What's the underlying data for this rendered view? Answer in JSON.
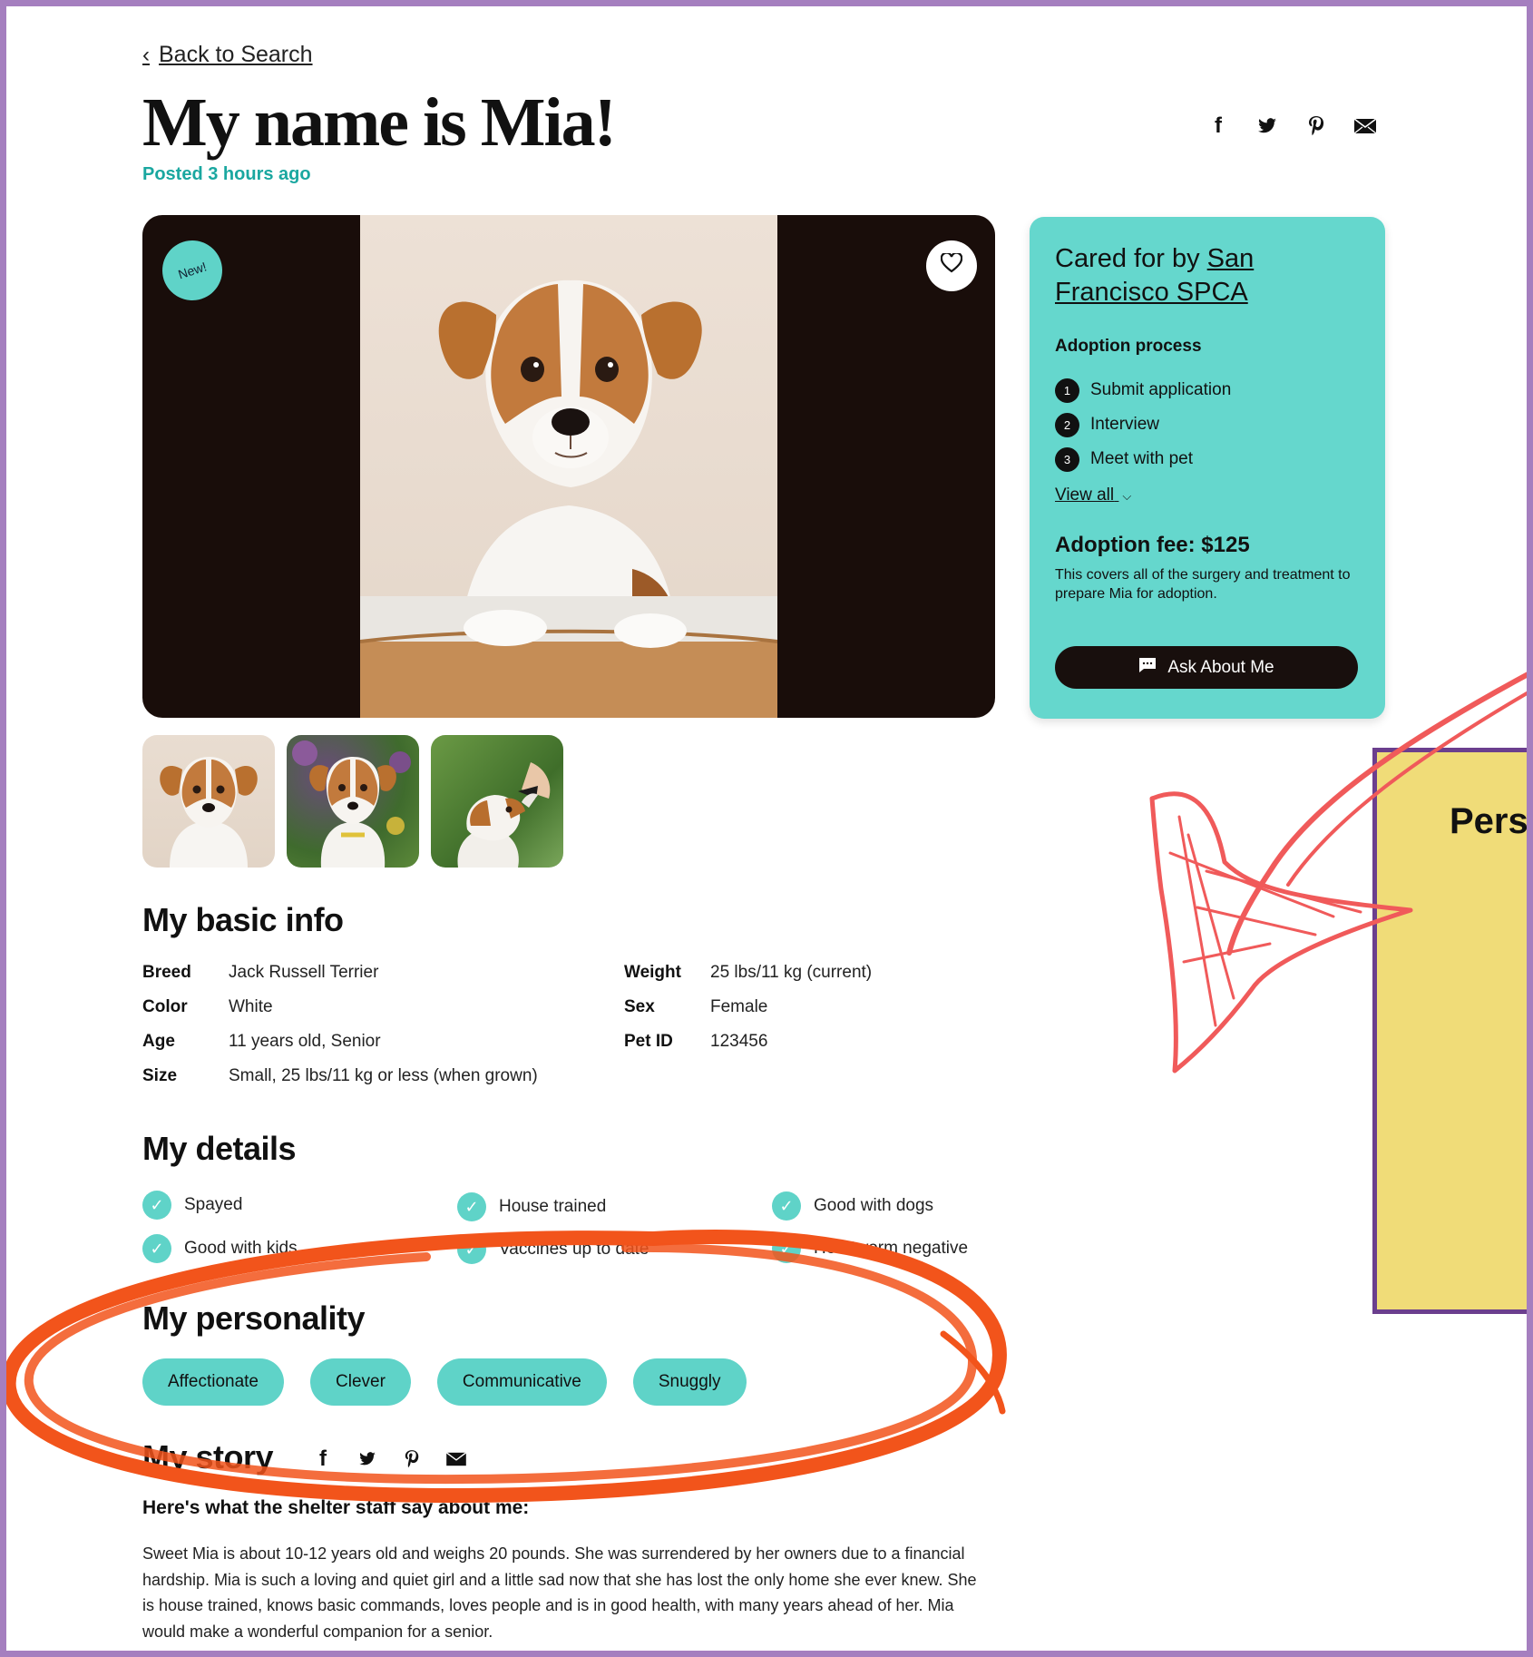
{
  "header": {
    "back_label": "Back to Search",
    "back_icon": "chevron-left-icon",
    "title": "My name is Mia!",
    "posted": "Posted 3 hours ago",
    "share_icons": [
      "facebook-icon",
      "twitter-icon",
      "pinterest-icon",
      "email-icon"
    ]
  },
  "hero": {
    "badge": "New!",
    "favorite_icon": "heart-icon"
  },
  "card": {
    "cared_prefix": "Cared for by ",
    "org_name": "San Francisco SPCA",
    "process_heading": "Adoption process",
    "steps": [
      {
        "num": "1",
        "label": "Submit application"
      },
      {
        "num": "2",
        "label": "Interview"
      },
      {
        "num": "3",
        "label": "Meet with pet"
      }
    ],
    "view_all": "View all",
    "fee_heading": "Adoption fee: $125",
    "fee_text": "This covers all of the surgery and treatment to prepare Mia for adoption.",
    "ask_button": "Ask About Me",
    "ask_icon": "chat-icon"
  },
  "basic_info": {
    "heading": "My basic info",
    "left": [
      {
        "k": "Breed",
        "v": "Jack Russell Terrier"
      },
      {
        "k": "Color",
        "v": "White"
      },
      {
        "k": "Age",
        "v": "11 years old, Senior"
      },
      {
        "k": "Size",
        "v": "Small, 25 lbs/11 kg or less (when grown)"
      }
    ],
    "right": [
      {
        "k": "Weight",
        "v": "25 lbs/11 kg (current)"
      },
      {
        "k": "Sex",
        "v": "Female"
      },
      {
        "k": "Pet ID",
        "v": "123456"
      }
    ]
  },
  "details": {
    "heading": "My details",
    "items": [
      "Spayed",
      "House trained",
      "Good with dogs",
      "Good with kids",
      "Vaccines up to date",
      "Heartworm negative"
    ]
  },
  "personality": {
    "heading": "My personality",
    "traits": [
      "Affectionate",
      "Clever",
      "Communicative",
      "Snuggly"
    ]
  },
  "story": {
    "heading": "My story",
    "subheading": "Here's what the shelter staff say about me:",
    "text": "Sweet Mia is about 10-12 years old and weighs 20 pounds. She was surrendered by her owners due to a financial hardship. Mia is such a loving and quiet girl and a little sad now that she has lost the only home she ever knew. She is house trained, knows basic commands, loves people and is in good health, with many years ahead of her. Mia would make a wonderful companion for a senior."
  },
  "note": {
    "title": "Pers"
  },
  "colors": {
    "accent": "#5fd3c8",
    "card": "#65d7cd",
    "posted_text": "#1aa7a0",
    "frame": "#a57fbf",
    "note": "#f0dc78",
    "note_border": "#6b3f8e",
    "scribble_orange": "#f2541b",
    "arrow_red": "#f05a5a"
  }
}
